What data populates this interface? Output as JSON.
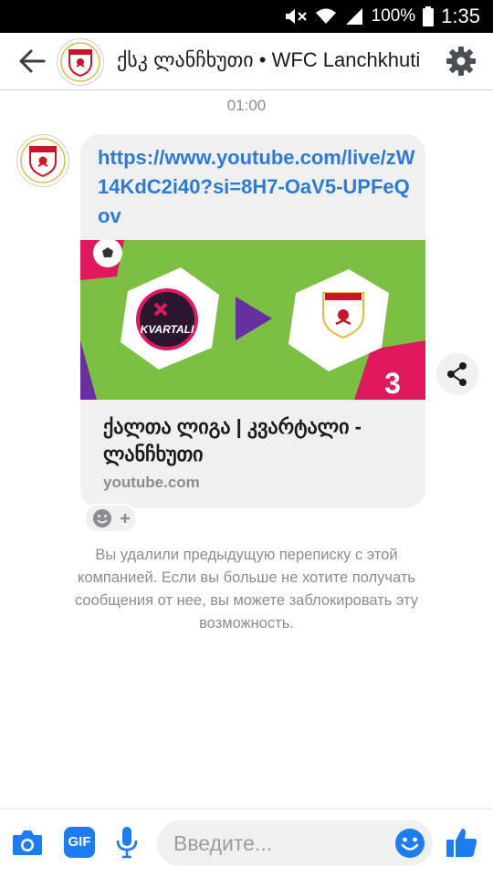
{
  "status_bar": {
    "battery": "100%",
    "time": "1:35"
  },
  "header": {
    "title": "ქსკ ლანჩხუთი • WFC Lanchkhuti",
    "avatar_label": "WFC LANCHKHUTI"
  },
  "conversation": {
    "timestamp": "01:00",
    "message": {
      "link": "https://www.youtube.com/live/zW14KdC2i40?si=8H7-OaV5-UPFeQov",
      "preview_title": "ქალთა ლიგა | კვარტალი - ლანჩხუთი",
      "preview_domain": "youtube.com",
      "preview_team_left": "KVARTALI",
      "preview_badge_number": "3"
    },
    "notice": "Вы удалили предыдущую переписку с этой компанией. Если вы больше не хотите получать сообщения от нее, вы можете заблокировать эту возможность."
  },
  "composer": {
    "gif_label": "GIF",
    "placeholder": "Введите..."
  },
  "colors": {
    "accent": "#1e7cf2",
    "link": "#2d7bd4",
    "bubble": "#f1f0f0",
    "preview_purple": "#6a2f9e",
    "preview_green": "#7bc043",
    "preview_pink": "#e0195f"
  },
  "icons": [
    "back-arrow-icon",
    "gear-icon",
    "share-icon",
    "reaction-smile-icon",
    "camera-icon",
    "gif-icon",
    "microphone-icon",
    "emoji-icon",
    "thumbs-up-icon"
  ]
}
